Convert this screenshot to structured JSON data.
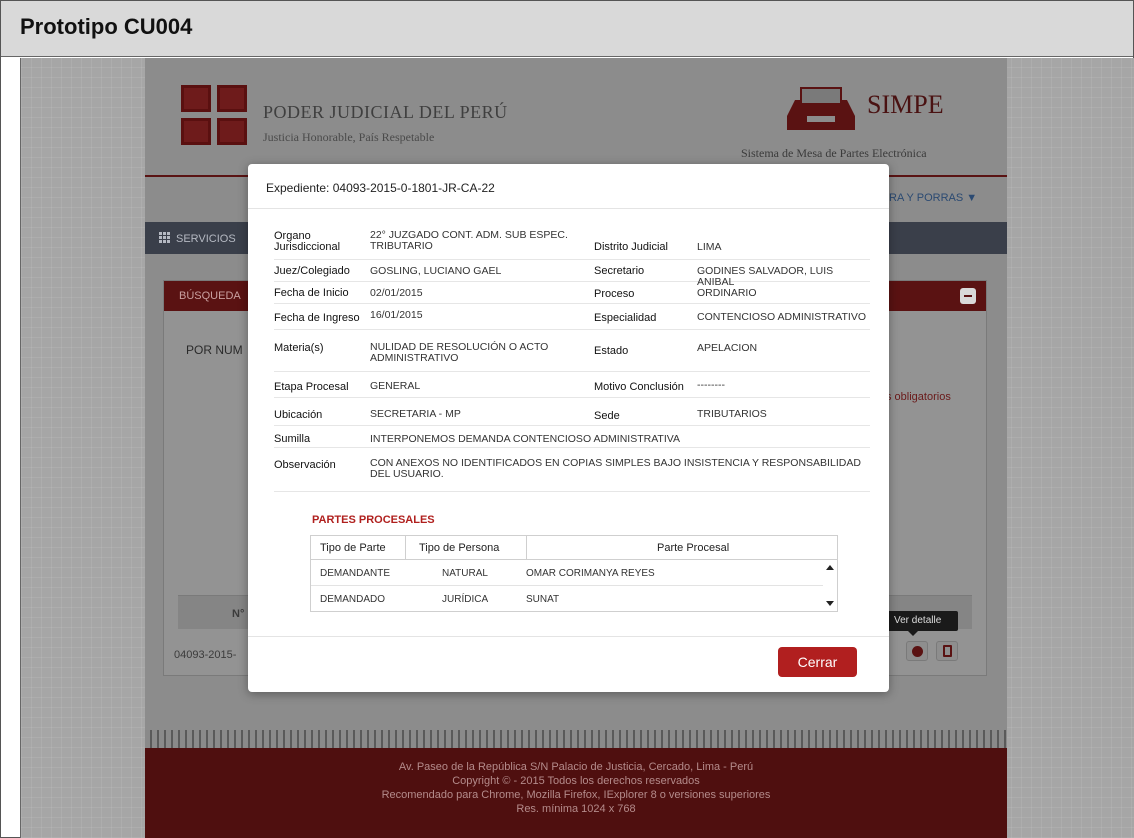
{
  "frame": {
    "title": "Prototipo CU004"
  },
  "site": {
    "org_name": "PODER JUDICIAL DEL PERÚ",
    "org_tagline": "Justicia Honorable, País Respetable",
    "system_title": "SIMPE",
    "system_subtitle": "Sistema de Mesa de Partes Electrónica",
    "user_menu": "RA Y PORRAS ▼",
    "nav_label": "SERVICIOS",
    "panel_title": "BÚSQUEDA",
    "search_tab": "POR NUM",
    "required_note": "s obligatorios",
    "results_header_num": "N° E",
    "results_row_num": "04093-2015-",
    "tooltip": "Ver detalle",
    "footer": [
      "Av. Paseo de la República S/N Palacio de Justicia, Cercado, Lima - Perú",
      "Copyright © - 2015 Todos los derechos reservados",
      "Recomendado para Chrome, Mozilla Firefox, IExplorer 8 o versiones superiores",
      "Res. mínima 1024 x 768"
    ]
  },
  "modal": {
    "title": "Expediente: 04093-2015-0-1801-JR-CA-22",
    "fields": {
      "organo_label": "Organo Jurisdiccional",
      "organo_value": "22° JUZGADO CONT. ADM. SUB ESPEC. TRIBUTARIO",
      "distrito_label": "Distrito Judicial",
      "distrito_value": "LIMA",
      "juez_label": "Juez/Colegiado",
      "juez_value": "GOSLING, LUCIANO GAEL",
      "secretario_label": "Secretario",
      "secretario_value": "GODINES SALVADOR, LUIS ANIBAL",
      "fecha_inicio_label": "Fecha de Inicio",
      "fecha_inicio_value": "02/01/2015",
      "proceso_label": "Proceso",
      "proceso_value": "ORDINARIO",
      "fecha_ingreso_label": "Fecha de Ingreso",
      "fecha_ingreso_value": "16/01/2015",
      "especialidad_label": "Especialidad",
      "especialidad_value": "CONTENCIOSO ADMINISTRATIVO",
      "materia_label": "Materia(s)",
      "materia_value": "NULIDAD DE RESOLUCIÓN O ACTO ADMINISTRATIVO",
      "estado_label": "Estado",
      "estado_value": "APELACION",
      "etapa_label": "Etapa Procesal",
      "etapa_value": "GENERAL",
      "motivo_label": "Motivo Conclusión",
      "motivo_value": "--------",
      "ubicacion_label": "Ubicación",
      "ubicacion_value": "SECRETARIA - MP",
      "sede_label": "Sede",
      "sede_value": "TRIBUTARIOS",
      "sumilla_label": "Sumilla",
      "sumilla_value": "INTERPONEMOS DEMANDA CONTENCIOSO ADMINISTRATIVA",
      "observacion_label": "Observación",
      "observacion_value": "CON ANEXOS NO IDENTIFICADOS EN COPIAS SIMPLES BAJO INSISTENCIA Y RESPONSABILIDAD DEL USUARIO."
    },
    "partes": {
      "title": "PARTES PROCESALES",
      "columns": [
        "Tipo de Parte",
        "Tipo de Persona",
        "Parte Procesal"
      ],
      "rows": [
        [
          "DEMANDANTE",
          "NATURAL",
          "OMAR  CORIMANYA REYES"
        ],
        [
          "DEMANDADO",
          "JURÍDICA",
          "SUNAT"
        ]
      ]
    },
    "close_label": "Cerrar"
  }
}
